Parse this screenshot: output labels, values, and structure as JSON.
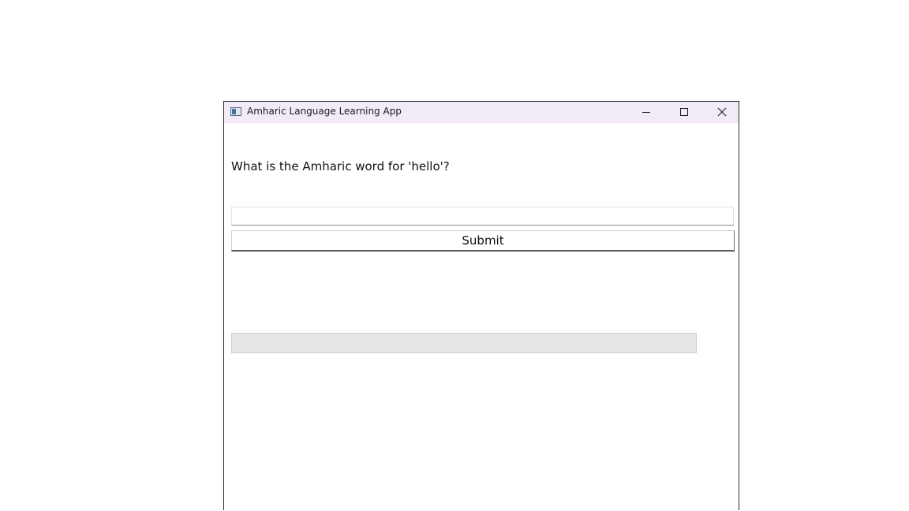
{
  "window": {
    "title": "Amharic Language Learning App",
    "titlebar_color": "#f3eaf8"
  },
  "controls": {
    "minimize_icon": "minimize-icon",
    "maximize_icon": "maximize-icon",
    "close_icon": "close-icon"
  },
  "quiz": {
    "question": "What is the Amharic word for 'hello'?",
    "answer_value": "",
    "answer_placeholder": "",
    "submit_label": "Submit",
    "feedback": ""
  },
  "progress": {
    "value": 0
  }
}
